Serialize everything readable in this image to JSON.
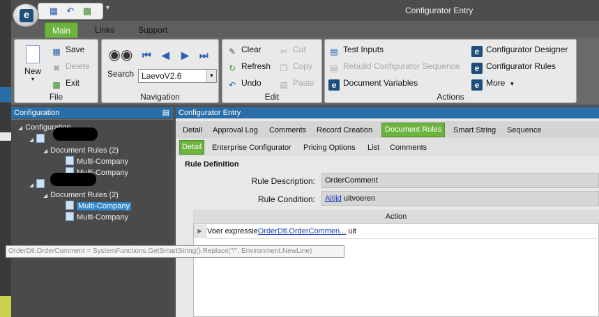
{
  "window": {
    "title": "Configurator Entry"
  },
  "ribbon_tabs": [
    {
      "label": "Main",
      "active": true
    },
    {
      "label": "Links",
      "active": false
    },
    {
      "label": "Support",
      "active": false
    }
  ],
  "file_group": {
    "label": "File",
    "new": "New",
    "save": "Save",
    "delete": "Delete",
    "exit": "Exit"
  },
  "nav_group": {
    "label": "Navigation",
    "search": "Search",
    "combo_value": "LaevoV2.6"
  },
  "edit_group": {
    "label": "Edit",
    "clear": "Clear",
    "cut": "Cut",
    "refresh": "Refresh",
    "copy": "Copy",
    "undo": "Undo",
    "paste": "Paste"
  },
  "actions_group": {
    "label": "Actions",
    "test_inputs": "Test Inputs",
    "rebuild": "Rebuild Configurator Sequence",
    "document_variables": "Document Variables",
    "designer": "Configurator Designer",
    "rules": "Configurator Rules",
    "more": "More"
  },
  "left_panel": {
    "title": "Configuration",
    "tree": {
      "root": "Configuration",
      "doc_rules_1": "Document Rules (2)",
      "mc_1a": "Multi-Company",
      "mc_1b": "Multi-Company",
      "doc_rules_2": "Document Rules (2)",
      "mc_2a": "Multi-Company",
      "mc_2b": "Multi-Company"
    }
  },
  "right_panel": {
    "title": "Configurator Entry",
    "tabs": [
      "Detail",
      "Approval Log",
      "Comments",
      "Record Creation",
      "Document Rules",
      "Smart String",
      "Sequence"
    ],
    "subtabs": [
      "Detail",
      "Enterprise Configurator",
      "Pricing Options",
      "List",
      "Comments"
    ],
    "section_title": "Rule Definition",
    "rule_description_label": "Rule Description:",
    "rule_description_value": "OrderComment",
    "rule_condition_label": "Rule Condition:",
    "rule_condition_link": "Altijd",
    "rule_condition_text": "uitvoeren",
    "action_header": "Action",
    "action_prefix": "Voer expressie",
    "action_link": "OrderDtl.OrderCommen...",
    "action_suffix": "uit"
  },
  "tooltip": "OrderDtl.OrderComment = SystemFunctions.GetSmartString().Replace(\"/\", Environment.NewLine)"
}
